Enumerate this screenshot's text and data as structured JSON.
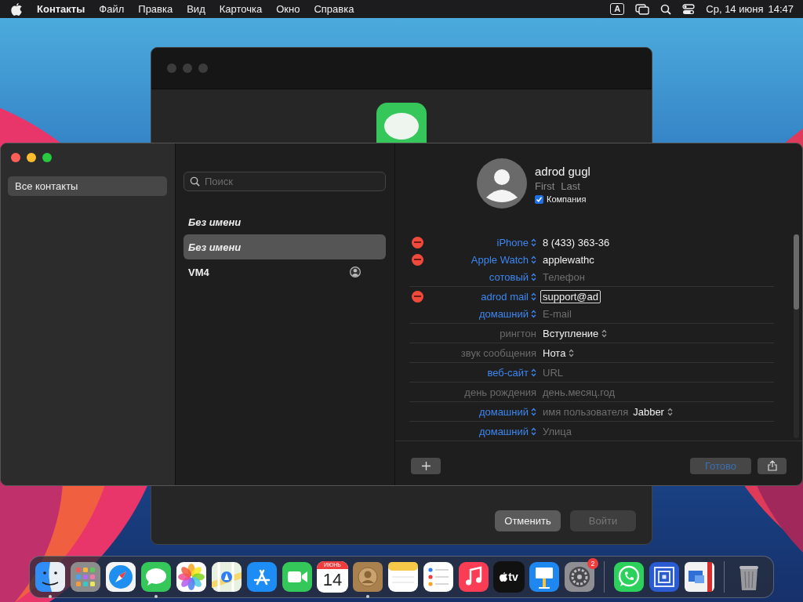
{
  "menu_bar": {
    "app_name": "Контакты",
    "menus": [
      "Файл",
      "Правка",
      "Вид",
      "Карточка",
      "Окно",
      "Справка"
    ],
    "input_source": "A",
    "date": "Ср, 14 июня",
    "time": "14:47"
  },
  "back_window": {
    "buttons": [
      {
        "label": "Отменить",
        "disabled": false
      },
      {
        "label": "Войти",
        "disabled": true
      }
    ]
  },
  "contacts_window": {
    "sidebar": {
      "items": [
        {
          "label": "Все контакты",
          "selected": true
        }
      ]
    },
    "list": {
      "search": {
        "placeholder": "Поиск"
      },
      "items": [
        {
          "name": "Без имени",
          "kind": "unnamed",
          "selected": false,
          "me": false
        },
        {
          "name": "Без имени",
          "kind": "unnamed",
          "selected": true,
          "me": false
        },
        {
          "name": "VM4",
          "kind": "named",
          "selected": false,
          "me": true
        }
      ]
    },
    "detail": {
      "name": "adrod gugl",
      "first_placeholder": "First",
      "last_placeholder": "Last",
      "company": {
        "label": "Компания",
        "checked": true
      },
      "groups": [
        {
          "rows": [
            {
              "label": "iPhone",
              "kind": "popup",
              "removable": true,
              "value": "8 (433) 363-36",
              "editing": false
            },
            {
              "label": "Apple Watch",
              "kind": "popup",
              "removable": true,
              "value": "applewathc",
              "editing": false
            },
            {
              "label": "сотовый",
              "kind": "popup",
              "removable": false,
              "placeholder": "Телефон"
            }
          ]
        },
        {
          "rows": [
            {
              "label": "adrod mail",
              "kind": "popup",
              "removable": true,
              "value": "support@ad",
              "editing": true
            },
            {
              "label": "домашний",
              "kind": "popup",
              "removable": false,
              "placeholder": "E-mail"
            }
          ]
        },
        {
          "rows": [
            {
              "label": "рингтон",
              "kind": "static",
              "removable": false,
              "popup_value": "Вступление"
            }
          ]
        },
        {
          "rows": [
            {
              "label": "звук сообщения",
              "kind": "static",
              "removable": false,
              "popup_value": "Нота"
            }
          ]
        },
        {
          "rows": [
            {
              "label": "веб-сайт",
              "kind": "popup",
              "removable": false,
              "placeholder": "URL"
            }
          ]
        },
        {
          "rows": [
            {
              "label": "день рождения",
              "kind": "static",
              "removable": false,
              "placeholder": "день.месяц.год"
            }
          ]
        },
        {
          "rows": [
            {
              "label": "домашний",
              "kind": "popup",
              "removable": false,
              "placeholder": "имя пользователя",
              "popup_value": "Jabber"
            }
          ]
        },
        {
          "rows": [
            {
              "label": "домашний",
              "kind": "popup",
              "removable": false,
              "placeholder": "Улица"
            }
          ]
        }
      ],
      "done_button": "Готово"
    }
  },
  "dock": {
    "sections": [
      [
        {
          "kind": "finder",
          "running": true
        },
        {
          "kind": "launchpad",
          "running": false
        },
        {
          "kind": "safari",
          "running": false
        },
        {
          "kind": "messages",
          "running": true
        },
        {
          "kind": "photos",
          "running": false
        },
        {
          "kind": "maps",
          "running": false
        },
        {
          "kind": "appstore",
          "running": false
        },
        {
          "kind": "facetime",
          "running": false
        },
        {
          "kind": "calendar",
          "running": false,
          "month": "ИЮНЬ",
          "day": "14"
        },
        {
          "kind": "contacts",
          "running": true
        },
        {
          "kind": "notes",
          "running": false
        },
        {
          "kind": "reminders",
          "running": false
        },
        {
          "kind": "music",
          "running": false
        },
        {
          "kind": "tv",
          "running": false,
          "label": "tv"
        },
        {
          "kind": "keynote",
          "running": false
        },
        {
          "kind": "settings",
          "running": false,
          "badge": "2"
        }
      ],
      [
        {
          "kind": "whatsapp",
          "running": false
        },
        {
          "kind": "squares",
          "running": false
        },
        {
          "kind": "remote",
          "running": false
        }
      ],
      [
        {
          "kind": "trash",
          "running": false
        }
      ]
    ]
  }
}
